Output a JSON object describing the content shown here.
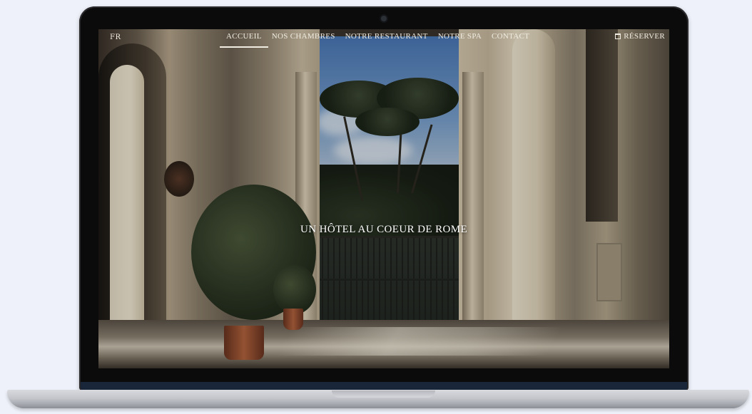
{
  "site": {
    "language": "FR",
    "nav": [
      {
        "label": "ACCUEIL",
        "active": true
      },
      {
        "label": "NOS CHAMBRES",
        "active": false
      },
      {
        "label": "NOTRE RESTAURANT",
        "active": false
      },
      {
        "label": "NOTRE SPA",
        "active": false
      },
      {
        "label": "CONTACT",
        "active": false
      }
    ],
    "reserve_label": "RÉSERVER",
    "reserve_icon": "calendar-icon",
    "hero_title": "UN HÔTEL AU COEUR DE ROME"
  },
  "colors": {
    "background": "#eef1f9",
    "bezel": "#0b0b0c",
    "text": "#f2ede2"
  }
}
